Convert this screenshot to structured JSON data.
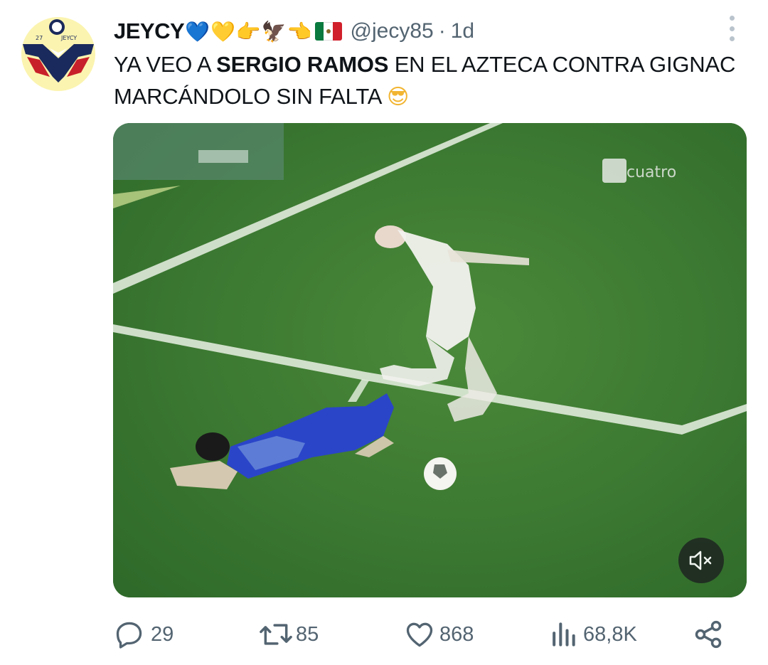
{
  "author": {
    "display_name": "JEYCY",
    "name_emojis": [
      "💙",
      "💛",
      "👉",
      "🦅",
      "👈"
    ],
    "handle": "@jecy85",
    "separator": "·",
    "time": "1d",
    "avatar_text": "27 JEYCY"
  },
  "tweet": {
    "text_before": "YA VEO A ",
    "text_bold": "SERGIO RAMOS",
    "text_after": " EN EL AZTECA CONTRA GIGNAC MARCÁNDOLO SIN FALTA ",
    "emoji": "😎"
  },
  "media": {
    "type": "video",
    "watermark": "cuatro",
    "mute_icon": "speaker-muted-icon"
  },
  "actions": {
    "replies": "29",
    "retweets": "85",
    "likes": "868",
    "views": "68,8K"
  },
  "colors": {
    "text": "#0f1419",
    "secondary": "#536471",
    "pitch": "#3f7a33",
    "avatar_bg": "#fbf4b0"
  }
}
